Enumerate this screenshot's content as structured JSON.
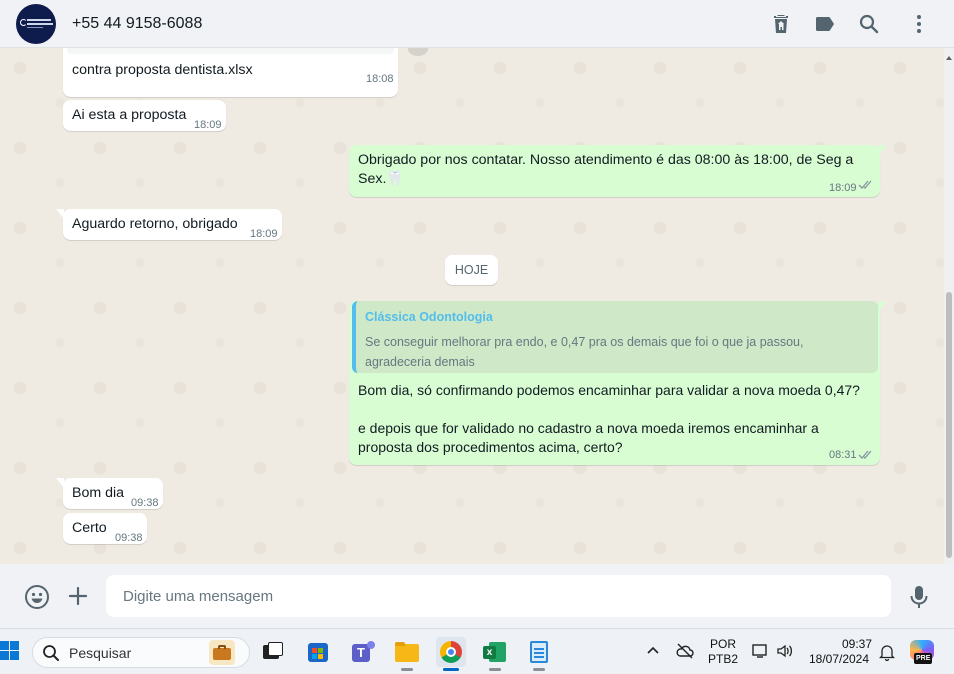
{
  "header": {
    "contact_name": "+55 44 9158-6088",
    "icons": [
      "delete-icon",
      "label-icon",
      "search-icon",
      "menu-icon"
    ]
  },
  "messages": [
    {
      "id": "m1",
      "direction": "in",
      "text": "contra proposta dentista.xlsx",
      "time": "18:08"
    },
    {
      "id": "m2",
      "direction": "in",
      "text": "Ai esta a proposta",
      "time": "18:09"
    },
    {
      "id": "m3",
      "direction": "out",
      "text_line1": "Obrigado por nos contatar. Nosso atendimento é das 08:00 às 18:00, de Seg a",
      "text_line2": "Sex.🦷",
      "time": "18:09",
      "status": "read"
    },
    {
      "id": "m4",
      "direction": "in",
      "text": "Aguardo retorno, obrigado",
      "time": "18:09"
    },
    {
      "id": "m5",
      "direction": "out",
      "quote": {
        "author": "Clássica Odontologia",
        "text": "Se conseguir melhorar pra endo, e 0,47 pra os demais que foi o que ja passou, agradeceria demais"
      },
      "text_line1": "Bom dia, só confirmando podemos encaminhar para validar a nova moeda 0,47?",
      "text_line2": "e depois que for validado no cadastro a nova moeda iremos encaminhar a",
      "text_line3": "proposta dos procedimentos acima, certo?",
      "time": "08:31",
      "status": "read"
    },
    {
      "id": "m6",
      "direction": "in",
      "text": "Bom dia",
      "time": "09:38"
    },
    {
      "id": "m7",
      "direction": "in",
      "text": "Certo",
      "time": "09:38"
    }
  ],
  "date_separator": "HOJE",
  "composer": {
    "placeholder": "Digite uma mensagem"
  },
  "taskbar": {
    "search_placeholder": "Pesquisar",
    "language": "POR",
    "keyboard": "PTB2",
    "time": "09:37",
    "date": "18/07/2024",
    "copilot_badge": "PRE"
  }
}
